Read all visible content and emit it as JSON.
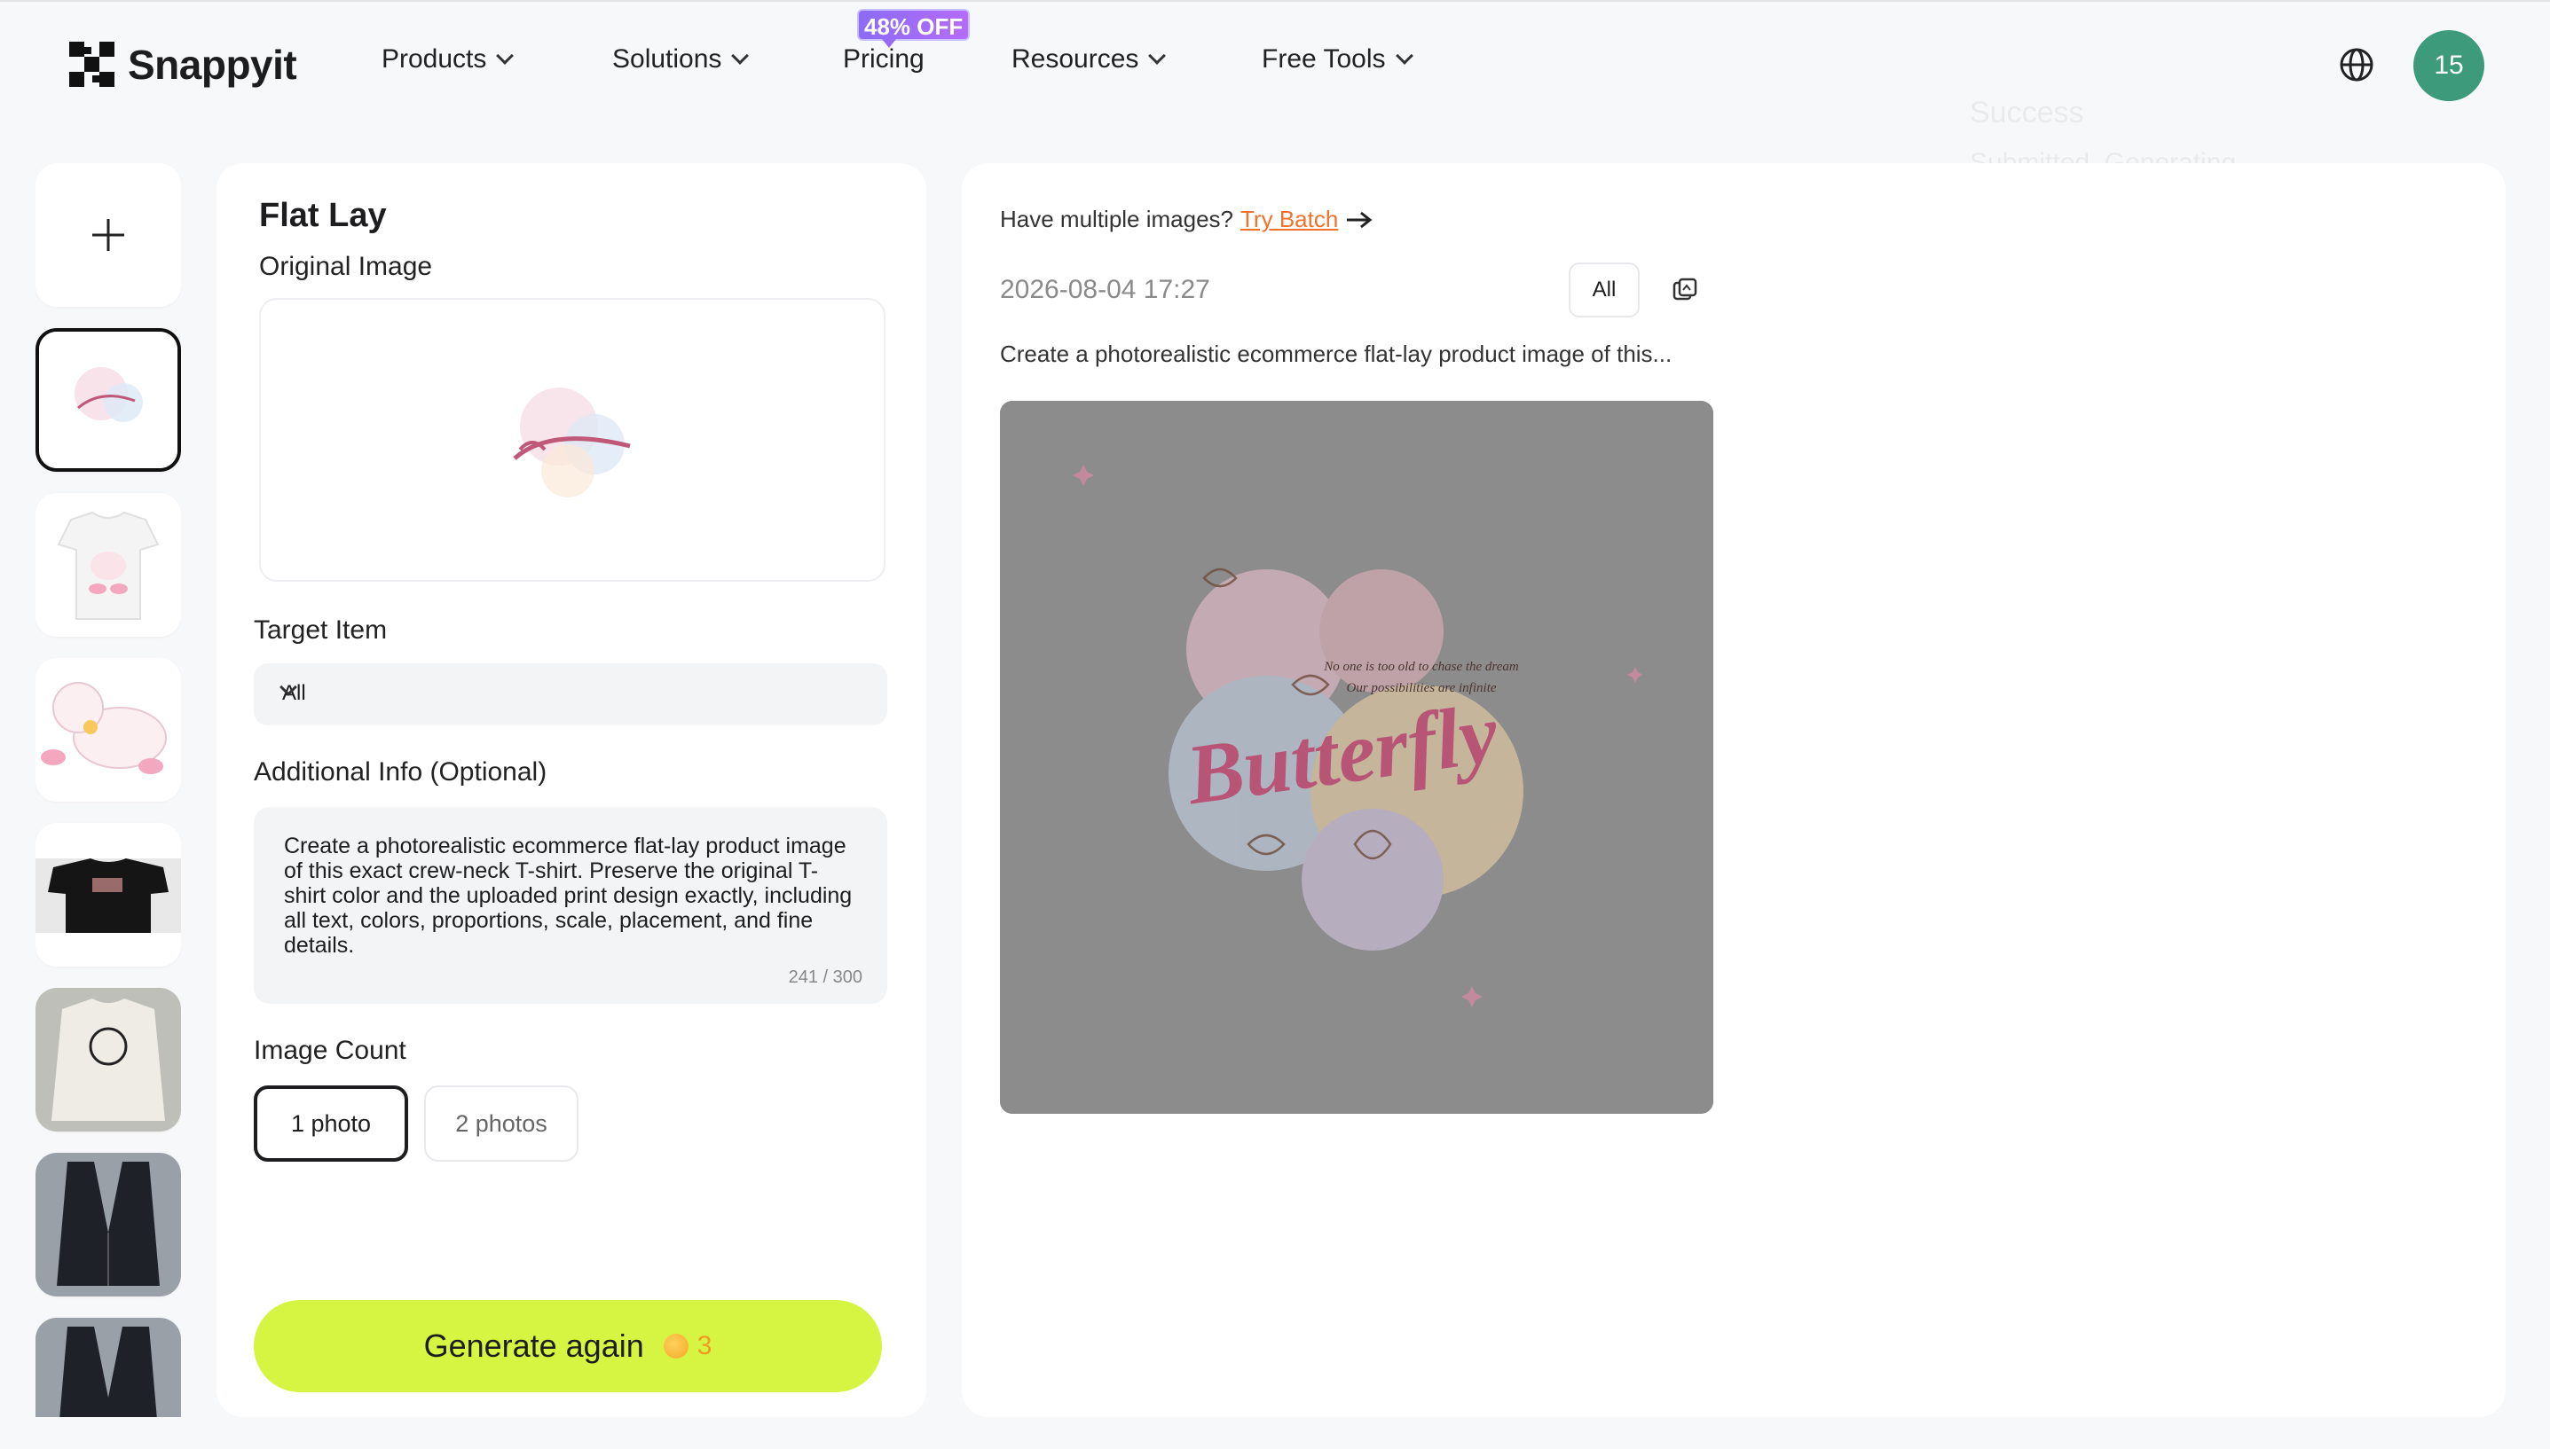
{
  "brand": {
    "name": "Snappyit"
  },
  "nav": {
    "items": [
      {
        "label": "Products",
        "has_dropdown": true
      },
      {
        "label": "Solutions",
        "has_dropdown": true
      },
      {
        "label": "Pricing",
        "has_dropdown": false
      },
      {
        "label": "Resources",
        "has_dropdown": true
      },
      {
        "label": "Free Tools",
        "has_dropdown": true
      }
    ],
    "pricing_badge": "48% OFF"
  },
  "user": {
    "credits": "15"
  },
  "toast": {
    "title": "Success",
    "message": "Submitted. Generating..."
  },
  "sidebar": {
    "thumbnails": [
      {
        "name": "butterfly-print",
        "selected": true
      },
      {
        "name": "white-cat-tshirt",
        "selected": false
      },
      {
        "name": "cat-illustration",
        "selected": false
      },
      {
        "name": "black-tshirt",
        "selected": false
      },
      {
        "name": "polo-sweatshirt",
        "selected": false
      },
      {
        "name": "black-vest",
        "selected": false
      },
      {
        "name": "black-vest-2",
        "selected": false
      }
    ]
  },
  "form": {
    "title": "Flat Lay",
    "original_image_label": "Original Image",
    "target_item_label": "Target Item",
    "target_item_value": "All",
    "additional_info_label": "Additional Info (Optional)",
    "additional_info_text": "Create a photorealistic ecommerce flat-lay product image of this exact crew-neck T-shirt. Preserve the original T-shirt color and the uploaded print design exactly, including all text, colors, proportions, scale, placement, and fine details.",
    "char_counter": "241 / 300",
    "image_count_label": "Image Count",
    "image_count_options": [
      "1 photo",
      "2 photos"
    ],
    "image_count_selected": "1 photo",
    "generate_label": "Generate again",
    "generate_cost": "3"
  },
  "result": {
    "batch_prompt": "Have multiple images?",
    "batch_link": "Try Batch",
    "timestamp": "2026-08-04 17:27",
    "filter_label": "All",
    "prompt_preview": "Create a photorealistic ecommerce flat-lay product image of this...",
    "design_text": {
      "line1": "No one is too old to chase the dream",
      "line2": "Our possibilities are infinite",
      "word": "Butterfly"
    }
  },
  "colors": {
    "accent": "#d6f542",
    "link": "#f2722c",
    "avatar": "#3d9a7a",
    "badge": "#9a6cf6",
    "overlay": "#8c8c8c",
    "script_pink": "#c0587a"
  }
}
